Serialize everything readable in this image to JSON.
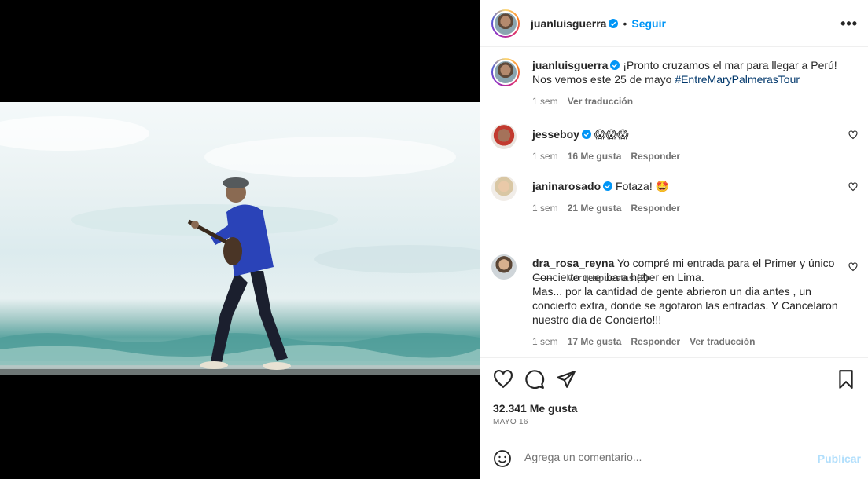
{
  "post": {
    "author": "juanluisguerra",
    "follow_label": "Seguir",
    "more_label": "•••",
    "caption": {
      "text": "¡Pronto cruzamos el mar para llegar a Perú! Nos vemos este 25 de mayo ",
      "hashtag": "#EntreMaryPalmerasTour",
      "time": "1 sem",
      "translate": "Ver traducción"
    },
    "likes": "32.341 Me gusta",
    "date": "MAYO 16"
  },
  "comments": [
    {
      "user": "jesseboy",
      "text": "😱😱😱",
      "time": "1 sem",
      "likes": "16 Me gusta",
      "reply": "Responder"
    },
    {
      "user": "janinarosado",
      "text": "Fotaza! 🤩",
      "time": "1 sem",
      "likes": "21 Me gusta",
      "reply": "Responder",
      "view_replies": "Ver respuestas (2)"
    },
    {
      "user": "dra_rosa_reyna",
      "text": "Yo compré mi entrada para el Primer y único Concierto que iba a haber en Lima.",
      "text2": "Mas... por la cantidad de gente abrieron un dia antes , un concierto extra, donde se agotaron las entradas. Y Cancelaron nuestro dia de Concierto!!!",
      "time": "1 sem",
      "likes": "17 Me gusta",
      "reply": "Responder",
      "translate": "Ver traducción"
    }
  ],
  "composer": {
    "placeholder": "Agrega un comentario...",
    "publish": "Publicar"
  },
  "colors": {
    "accent": "#0095f6",
    "publish_disabled": "#b2dffc",
    "hashtag": "#00376b",
    "muted": "#737373"
  }
}
